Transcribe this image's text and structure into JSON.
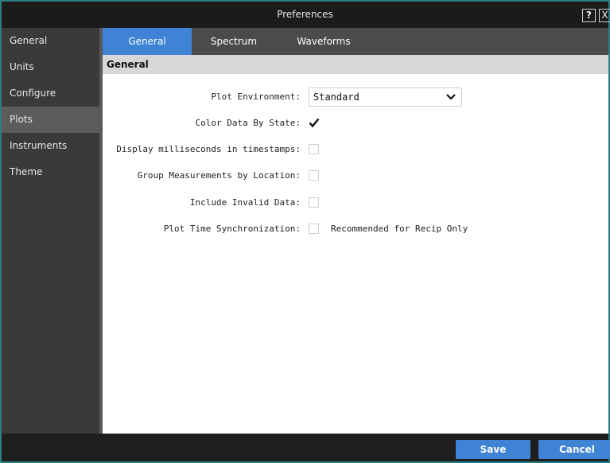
{
  "window": {
    "title": "Preferences",
    "help_label": "?",
    "close_label": "X"
  },
  "sidebar": {
    "items": [
      {
        "label": "General"
      },
      {
        "label": "Units"
      },
      {
        "label": "Configure"
      },
      {
        "label": "Plots",
        "active": true
      },
      {
        "label": "Instruments"
      },
      {
        "label": "Theme"
      }
    ]
  },
  "tabs": [
    {
      "label": "General",
      "active": true
    },
    {
      "label": "Spectrum"
    },
    {
      "label": "Waveforms"
    }
  ],
  "section": {
    "title": "General"
  },
  "settings": {
    "plot_environment": {
      "label": "Plot Environment:",
      "value": "Standard"
    },
    "color_data_by_state": {
      "label": "Color Data By State:",
      "checked": true
    },
    "display_ms": {
      "label": "Display milliseconds in timestamps:",
      "checked": false
    },
    "group_by_location": {
      "label": "Group Measurements by Location:",
      "checked": false
    },
    "include_invalid": {
      "label": "Include Invalid Data:",
      "checked": false
    },
    "plot_time_sync": {
      "label": "Plot Time Synchronization:",
      "checked": false,
      "note": "Recommended for Recip Only"
    }
  },
  "footer": {
    "save_label": "Save",
    "cancel_label": "Cancel"
  },
  "colors": {
    "accent": "#3f83d4",
    "border": "#2a7f84"
  }
}
